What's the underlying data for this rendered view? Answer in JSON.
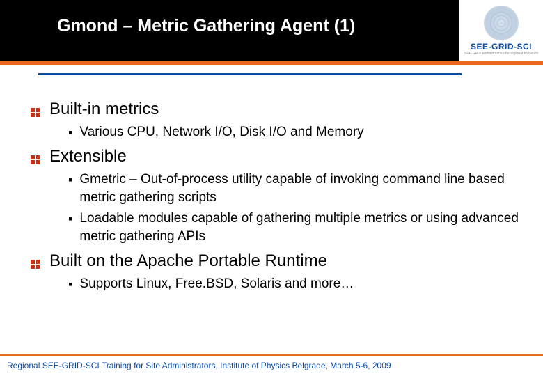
{
  "header": {
    "title": "Gmond – Metric Gathering Agent (1)",
    "logo_text": "SEE-GRID-SCI",
    "logo_sub": "SEE-GRID eInfrastructure for regional eScience"
  },
  "content": {
    "items": [
      {
        "label": "Built-in metrics",
        "sub": [
          "Various CPU, Network I/O, Disk I/O and Memory"
        ]
      },
      {
        "label": "Extensible",
        "sub": [
          "Gmetric – Out-of-process utility capable of invoking command line based metric gathering scripts",
          "Loadable modules capable of gathering multiple metrics or using advanced metric gathering APIs"
        ]
      },
      {
        "label": "Built on the Apache Portable Runtime",
        "sub": [
          "Supports Linux, Free.BSD, Solaris and more…"
        ]
      }
    ]
  },
  "footer": {
    "text": "Regional SEE-GRID-SCI Training for Site Administrators, Institute of Physics Belgrade, March 5-6, 2009"
  }
}
